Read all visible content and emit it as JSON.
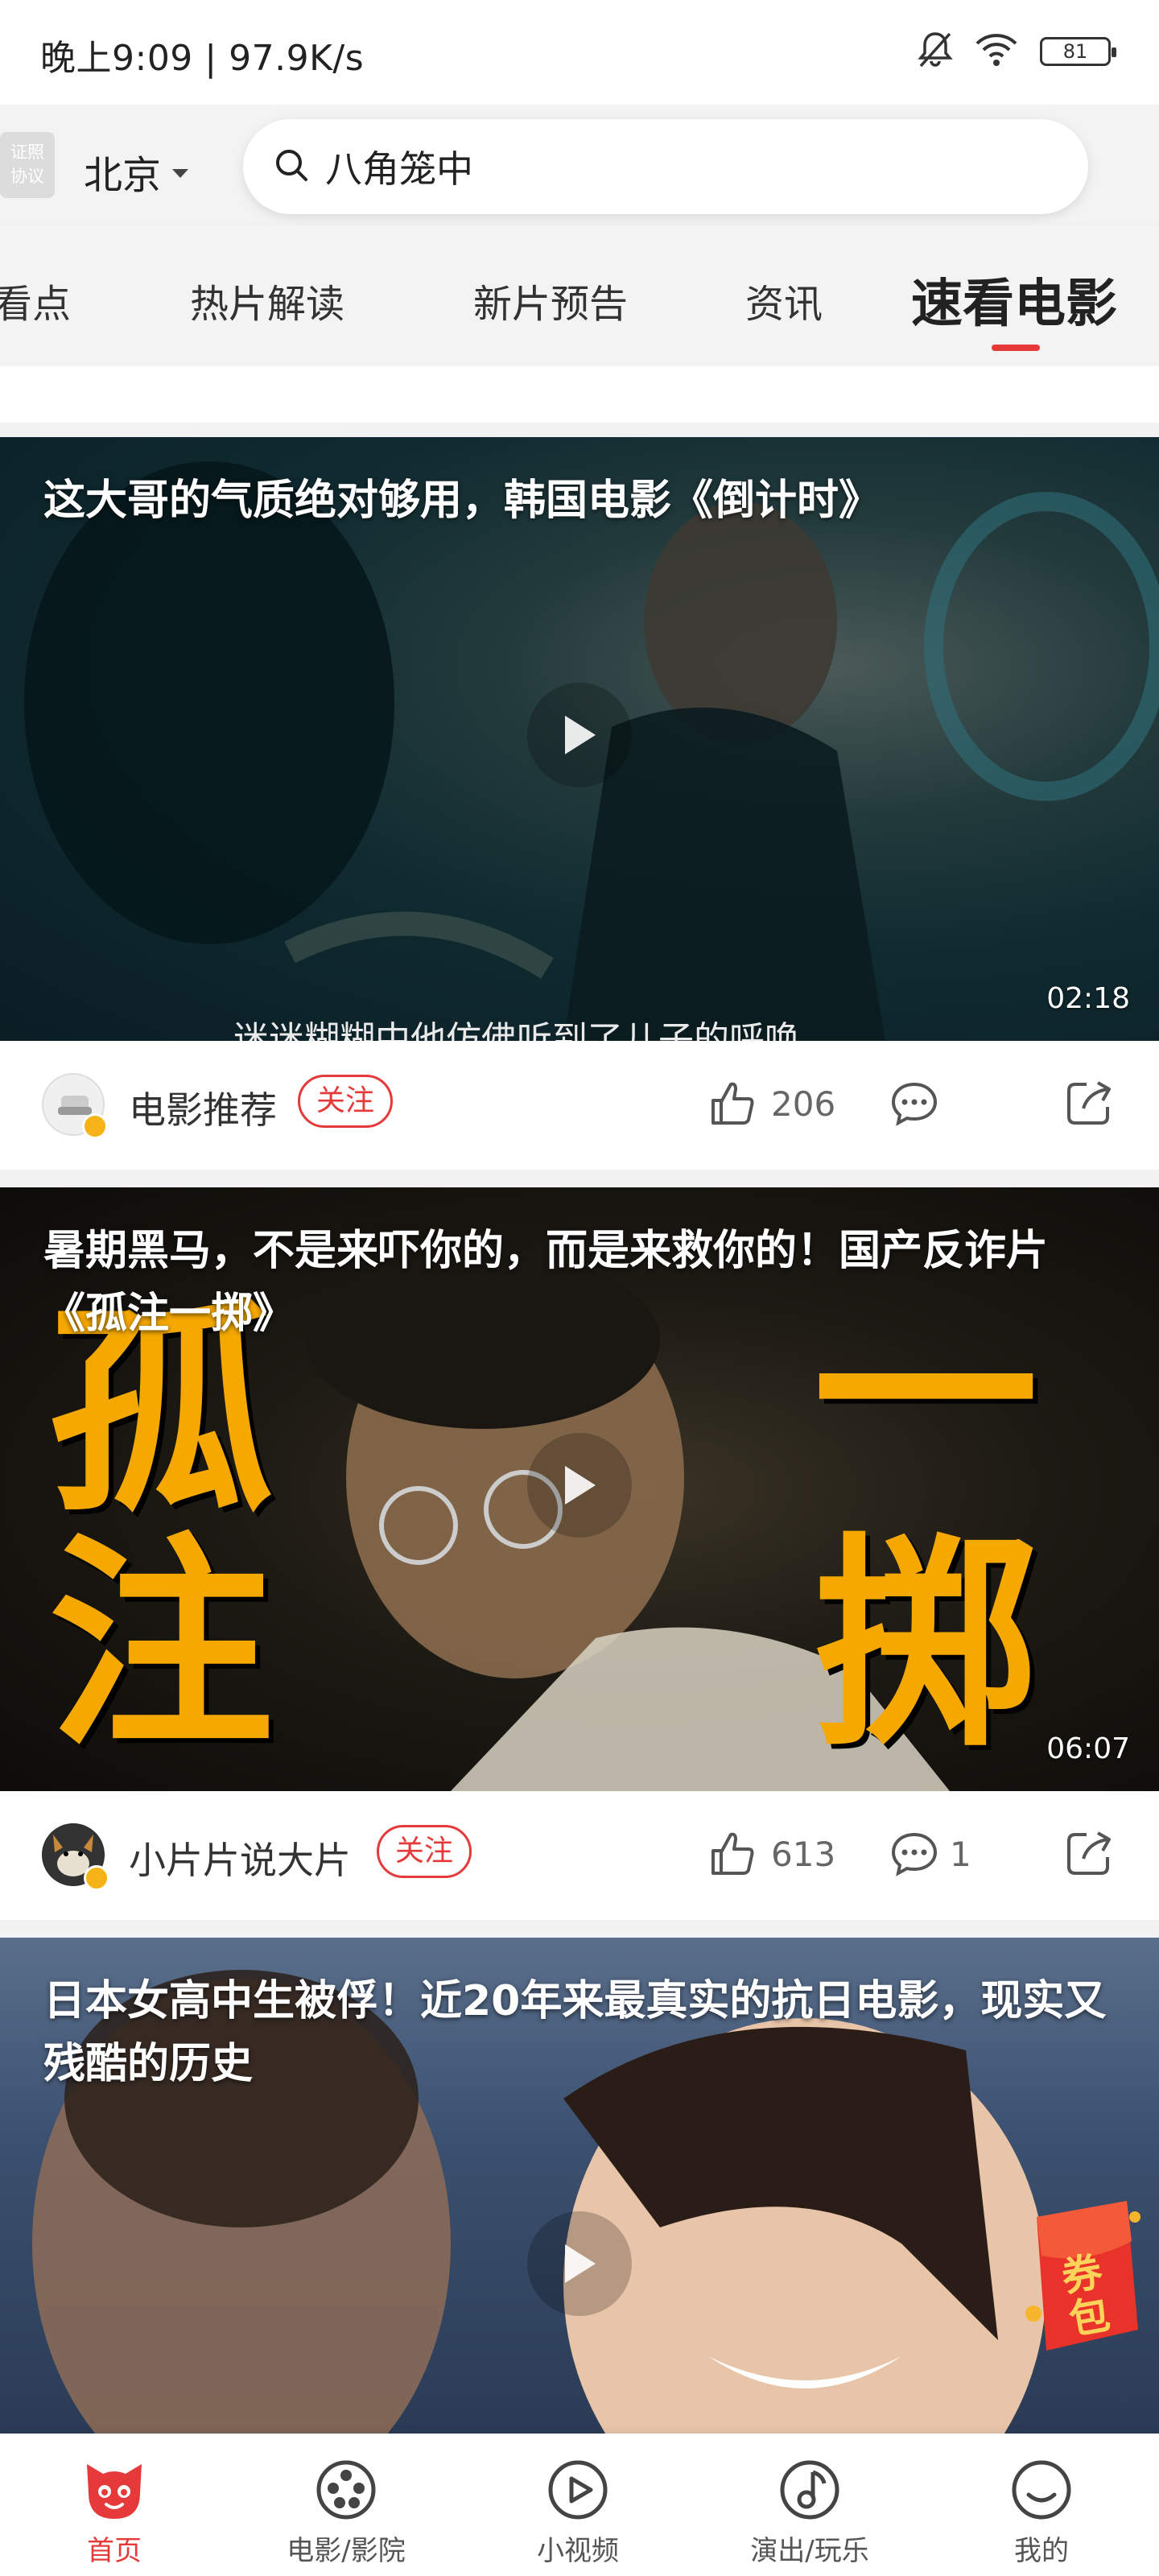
{
  "status_bar": {
    "time_speed": "晚上9:09 | 97.9K/s",
    "battery": "81",
    "icons": [
      "bell-off-icon",
      "wifi-icon",
      "battery-icon"
    ]
  },
  "header": {
    "license_badge": [
      "证照",
      "协议"
    ],
    "city": "北京",
    "search_value": "八角笼中"
  },
  "tabs": {
    "items": [
      "看点",
      "热片解读",
      "新片预告",
      "资讯",
      "速看电影"
    ],
    "active": "速看电影",
    "accent_color": "#e63a3a"
  },
  "feed": {
    "cards": [
      {
        "title": "这大哥的气质绝对够用，韩国电影《倒计时》",
        "duration": "02:18",
        "subtitle_peek": "迷迷糊糊中他仿佛听到了儿子的呼唤",
        "author": "电影推荐",
        "follow": "关注",
        "likes": "206",
        "comments": ""
      },
      {
        "title": "暑期黑马，不是来吓你的，而是来救你的！国产反诈片《孤注一掷》",
        "duration": "06:07",
        "poster_text": [
          "孤",
          "注",
          "一",
          "掷"
        ],
        "author": "小片片说大片",
        "follow": "关注",
        "likes": "613",
        "comments": "1"
      },
      {
        "title": "日本女高中生被俘！近20年来最真实的抗日电影，现实又残酷的历史"
      }
    ],
    "coupon_label": "券包"
  },
  "bottom_nav": {
    "items": [
      {
        "label": "首页",
        "icon": "cat-face-icon",
        "active": true
      },
      {
        "label": "电影/影院",
        "icon": "film-reel-icon",
        "active": false
      },
      {
        "label": "小视频",
        "icon": "play-circle-icon",
        "active": false
      },
      {
        "label": "演出/玩乐",
        "icon": "music-note-icon",
        "active": false
      },
      {
        "label": "我的",
        "icon": "profile-circle-icon",
        "active": false
      }
    ]
  }
}
